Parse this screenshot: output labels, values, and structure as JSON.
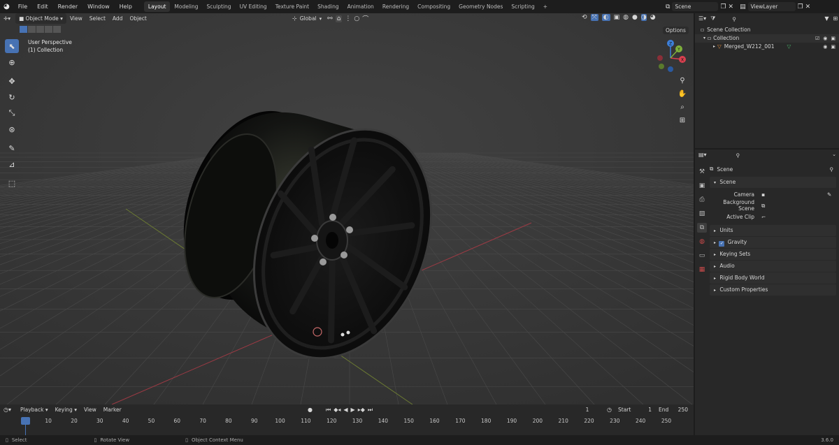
{
  "menu": {
    "items": [
      "File",
      "Edit",
      "Render",
      "Window",
      "Help"
    ],
    "workspaces": [
      "Layout",
      "Modeling",
      "Sculpting",
      "UV Editing",
      "Texture Paint",
      "Shading",
      "Animation",
      "Rendering",
      "Compositing",
      "Geometry Nodes",
      "Scripting"
    ],
    "active_workspace": "Layout",
    "add_tab": "+",
    "scene_field": "Scene",
    "viewlayer_field": "ViewLayer"
  },
  "viewport": {
    "mode": "Object Mode",
    "menus": [
      "View",
      "Select",
      "Add",
      "Object"
    ],
    "orientation": "Global",
    "options": "Options",
    "overlay_title": "User Perspective",
    "overlay_subtitle": "(1) Collection",
    "gizmo": {
      "x": "X",
      "y": "Y",
      "z": "Z"
    }
  },
  "outliner": {
    "root": "Scene Collection",
    "collection": "Collection",
    "object": "Merged_W212_001"
  },
  "properties": {
    "context": "Scene",
    "panel_scene": "Scene",
    "camera_label": "Camera",
    "bg_scene_label": "Background Scene",
    "active_clip_label": "Active Clip",
    "subpanels": [
      "Units",
      "Gravity",
      "Keying Sets",
      "Audio",
      "Rigid Body World",
      "Custom Properties"
    ],
    "gravity_checked": true
  },
  "timeline": {
    "menus": [
      "Playback",
      "Keying",
      "View",
      "Marker"
    ],
    "current_frame": "1",
    "start_label": "Start",
    "start_value": "1",
    "end_label": "End",
    "end_value": "250",
    "ruler": [
      "1",
      "10",
      "20",
      "30",
      "40",
      "50",
      "60",
      "70",
      "80",
      "90",
      "100",
      "110",
      "120",
      "130",
      "140",
      "150",
      "160",
      "170",
      "180",
      "190",
      "200",
      "210",
      "220",
      "230",
      "240",
      "250"
    ]
  },
  "status": {
    "select": "Select",
    "rotate": "Rotate View",
    "context_menu": "Object Context Menu",
    "version": "3.6.0"
  },
  "colors": {
    "accent": "#4772b3",
    "x_axis": "#d9404f",
    "y_axis": "#7fb13b",
    "z_axis": "#3d7fd9"
  }
}
